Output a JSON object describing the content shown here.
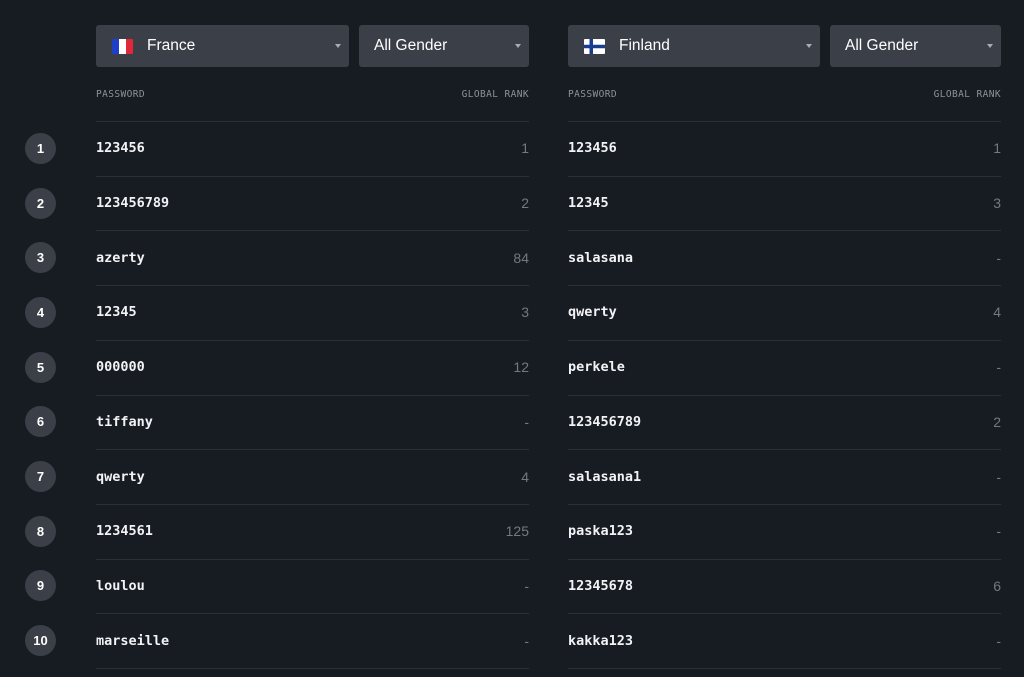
{
  "left": {
    "country": "France",
    "flag_icon": "france-flag-icon",
    "gender": "All Gender",
    "col_password": "PASSWORD",
    "col_rank": "GLOBAL RANK",
    "rows": [
      {
        "password": "123456",
        "rank": "1"
      },
      {
        "password": "123456789",
        "rank": "2"
      },
      {
        "password": "azerty",
        "rank": "84"
      },
      {
        "password": "12345",
        "rank": "3"
      },
      {
        "password": "000000",
        "rank": "12"
      },
      {
        "password": "tiffany",
        "rank": "-"
      },
      {
        "password": "qwerty",
        "rank": "4"
      },
      {
        "password": "1234561",
        "rank": "125"
      },
      {
        "password": "loulou",
        "rank": "-"
      },
      {
        "password": "marseille",
        "rank": "-"
      }
    ]
  },
  "right": {
    "country": "Finland",
    "flag_icon": "finland-flag-icon",
    "gender": "All Gender",
    "col_password": "PASSWORD",
    "col_rank": "GLOBAL RANK",
    "rows": [
      {
        "password": "123456",
        "rank": "1"
      },
      {
        "password": "12345",
        "rank": "3"
      },
      {
        "password": "salasana",
        "rank": "-"
      },
      {
        "password": "qwerty",
        "rank": "4"
      },
      {
        "password": "perkele",
        "rank": "-"
      },
      {
        "password": "123456789",
        "rank": "2"
      },
      {
        "password": "salasana1",
        "rank": "-"
      },
      {
        "password": "paska123",
        "rank": "-"
      },
      {
        "password": "12345678",
        "rank": "6"
      },
      {
        "password": "kakka123",
        "rank": "-"
      }
    ]
  },
  "ranks": [
    "1",
    "2",
    "3",
    "4",
    "5",
    "6",
    "7",
    "8",
    "9",
    "10"
  ],
  "colors": {
    "background": "#171b22",
    "control": "#3b3f47",
    "divider": "#2a2f38",
    "muted_text": "#737882",
    "header_text": "#8d929b"
  }
}
